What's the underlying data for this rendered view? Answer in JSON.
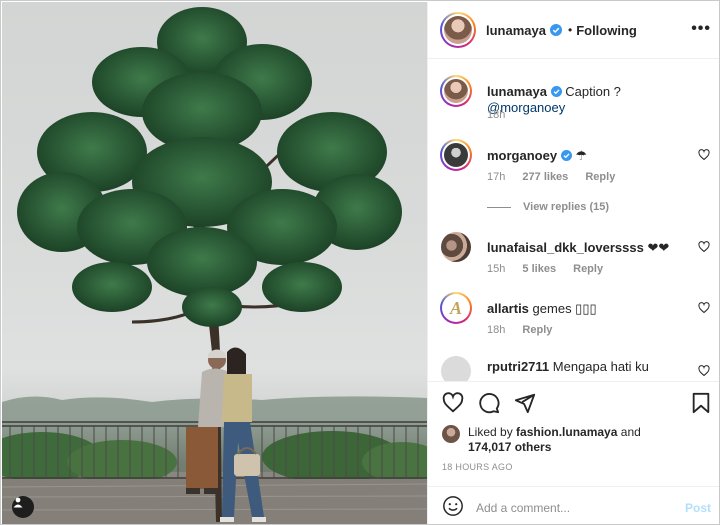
{
  "post": {
    "author": "lunamaya",
    "separator": "•",
    "follow_state": "Following",
    "more_label": "•••"
  },
  "caption": {
    "username": "lunamaya",
    "text": "Caption ?",
    "mention": "@morganoey",
    "time": "18h"
  },
  "comments": [
    {
      "username": "morganoey",
      "text": "☂",
      "time": "17h",
      "likes": "277 likes",
      "reply": "Reply",
      "verified": true
    },
    {
      "username": "lunafaisal_dkk_loverssss",
      "text": "❤❤",
      "time": "15h",
      "likes": "5 likes",
      "reply": "Reply"
    },
    {
      "username": "allartis",
      "text": "gemes ▯▯▯",
      "time": "18h",
      "reply": "Reply"
    },
    {
      "username": "rputri2711",
      "text": "Mengapa hati ku"
    }
  ],
  "view_replies": "View replies (15)",
  "likes": {
    "prefix": "Liked by",
    "user": "fashion.lunamaya",
    "and": "and",
    "others": "174,017 others"
  },
  "timestamp": "18 HOURS AGO",
  "composer": {
    "placeholder": "Add a comment...",
    "post_label": "Post"
  },
  "colors": {
    "verified": "#3897f0",
    "post_disabled": "#b2dffc",
    "link": "#00376b"
  },
  "icons": [
    "heart-icon",
    "comment-icon",
    "share-icon",
    "bookmark-icon",
    "emoji-icon",
    "user-tag-icon",
    "more-icon",
    "verified-icon"
  ]
}
